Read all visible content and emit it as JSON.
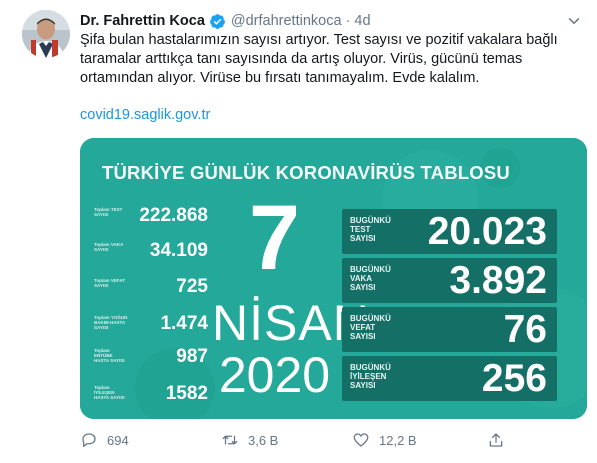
{
  "author": {
    "name": "Dr. Fahrettin Koca",
    "handle": "@drfahrettinkoca",
    "time": "4d"
  },
  "tweet": {
    "text": "Şifa bulan hastalarımızın sayısı artıyor. Test sayısı ve pozitif vakalara bağlı taramalar arttıkça tanı sayısında da artış oluyor. Virüs, gücünü temas ortamından alıyor. Virüse bu fırsatı tanımayalım. Evde kalalım.",
    "link": "covid19.saglik.gov.tr"
  },
  "card": {
    "title": "TÜRKİYE GÜNLÜK KORONAVİRÜS TABLOSU",
    "background": "#24a899",
    "box_color": "#146f66",
    "date": {
      "day": "7",
      "month": "NİSAN",
      "year": "2020"
    },
    "totals": [
      {
        "label": "Toplam TEST SAYISI",
        "value": "222.868"
      },
      {
        "label": "Toplam VAKA SAYISI",
        "value": "34.109"
      },
      {
        "label": "Toplam VEFAT SAYISI",
        "value": "725"
      },
      {
        "label": "Toplam YOĞUN BAKIM HASTA SAYISI",
        "value": "1.474"
      },
      {
        "label": "Toplam ENTÜBE HASTA SAYISI",
        "value": "987"
      },
      {
        "label": "Toplam İYİLEŞEN HASTA SAYISI",
        "value": "1582"
      }
    ],
    "today": [
      {
        "label": "BUGÜNKÜ TEST SAYISI",
        "value": "20.023"
      },
      {
        "label": "BUGÜNKÜ VAKA SAYISI",
        "value": "3.892"
      },
      {
        "label": "BUGÜNKÜ VEFAT SAYISI",
        "value": "76"
      },
      {
        "label": "BUGÜNKÜ İYİLEŞEN SAYISI",
        "value": "256"
      }
    ]
  },
  "actions": {
    "replies": "694",
    "retweets": "3,6 B",
    "likes": "12,2 B"
  },
  "icons": {
    "verified": "verified-badge-icon",
    "menu": "chevron-down-icon",
    "reply": "reply-icon",
    "retweet": "retweet-icon",
    "like": "heart-icon",
    "share": "share-icon"
  },
  "colors": {
    "link": "#1b95e0",
    "muted": "#657786",
    "verified": "#1da1f2"
  }
}
